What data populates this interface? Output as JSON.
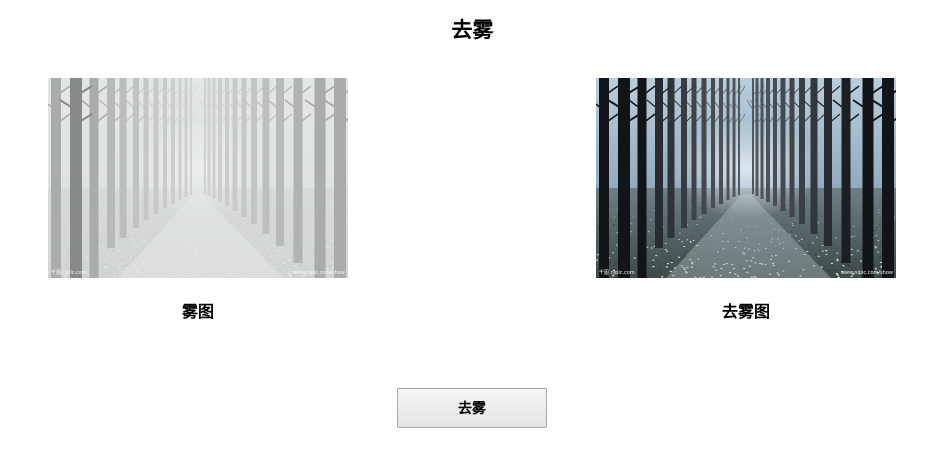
{
  "window": {
    "title": "去雾"
  },
  "panels": {
    "foggy": {
      "caption": "雾图",
      "watermark_left": "千图 nipic.com",
      "watermark_right": "www.nipic.com/show"
    },
    "dehazed": {
      "caption": "去雾图",
      "watermark_left": "千图 nipic.com",
      "watermark_right": "www.nipic.com/show"
    }
  },
  "actions": {
    "dehaze_label": "去雾"
  },
  "colors": {
    "background": "#ffffff",
    "text": "#000000",
    "button_border": "#a8a8a8",
    "button_top": "#f6f6f6",
    "button_bottom": "#e4e4e4"
  }
}
